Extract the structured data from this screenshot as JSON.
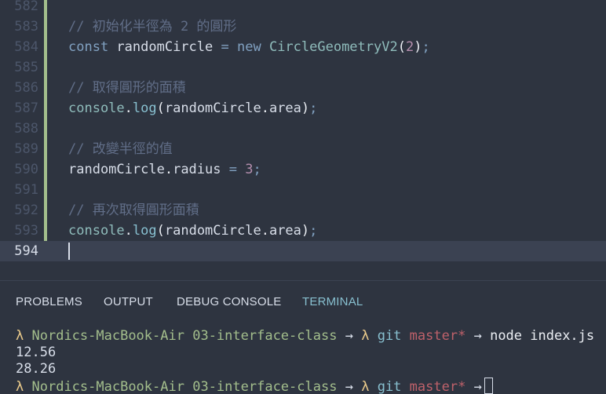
{
  "editor": {
    "lines": [
      {
        "num": "582",
        "tokens": []
      },
      {
        "num": "583",
        "tokens": [
          {
            "t": "comment",
            "v": "// 初始化半徑為 2 的圓形"
          }
        ]
      },
      {
        "num": "584",
        "tokens": [
          {
            "t": "keyword",
            "v": "const"
          },
          {
            "t": "plain",
            "v": " randomCircle "
          },
          {
            "t": "op",
            "v": "="
          },
          {
            "t": "plain",
            "v": " "
          },
          {
            "t": "keyword",
            "v": "new"
          },
          {
            "t": "plain",
            "v": " "
          },
          {
            "t": "class",
            "v": "CircleGeometryV2"
          },
          {
            "t": "punct",
            "v": "("
          },
          {
            "t": "num",
            "v": "2"
          },
          {
            "t": "punct",
            "v": ")"
          },
          {
            "t": "semi",
            "v": ";"
          }
        ]
      },
      {
        "num": "585",
        "tokens": []
      },
      {
        "num": "586",
        "tokens": [
          {
            "t": "comment",
            "v": "// 取得圓形的面積"
          }
        ]
      },
      {
        "num": "587",
        "tokens": [
          {
            "t": "class",
            "v": "console"
          },
          {
            "t": "punct",
            "v": "."
          },
          {
            "t": "func",
            "v": "log"
          },
          {
            "t": "punct",
            "v": "("
          },
          {
            "t": "plain",
            "v": "randomCircle"
          },
          {
            "t": "punct",
            "v": "."
          },
          {
            "t": "plain",
            "v": "area"
          },
          {
            "t": "punct",
            "v": ")"
          },
          {
            "t": "semi",
            "v": ";"
          }
        ]
      },
      {
        "num": "588",
        "tokens": []
      },
      {
        "num": "589",
        "tokens": [
          {
            "t": "comment",
            "v": "// 改變半徑的值"
          }
        ]
      },
      {
        "num": "590",
        "tokens": [
          {
            "t": "plain",
            "v": "randomCircle"
          },
          {
            "t": "punct",
            "v": "."
          },
          {
            "t": "plain",
            "v": "radius "
          },
          {
            "t": "op",
            "v": "="
          },
          {
            "t": "plain",
            "v": " "
          },
          {
            "t": "num",
            "v": "3"
          },
          {
            "t": "semi",
            "v": ";"
          }
        ]
      },
      {
        "num": "591",
        "tokens": []
      },
      {
        "num": "592",
        "tokens": [
          {
            "t": "comment",
            "v": "// 再次取得圓形面積"
          }
        ]
      },
      {
        "num": "593",
        "tokens": [
          {
            "t": "class",
            "v": "console"
          },
          {
            "t": "punct",
            "v": "."
          },
          {
            "t": "func",
            "v": "log"
          },
          {
            "t": "punct",
            "v": "("
          },
          {
            "t": "plain",
            "v": "randomCircle"
          },
          {
            "t": "punct",
            "v": "."
          },
          {
            "t": "plain",
            "v": "area"
          },
          {
            "t": "punct",
            "v": ")"
          },
          {
            "t": "semi",
            "v": ";"
          }
        ]
      },
      {
        "num": "594",
        "tokens": [],
        "current": true
      }
    ]
  },
  "panel": {
    "tabs": [
      {
        "label": "PROBLEMS",
        "active": false
      },
      {
        "label": "OUTPUT",
        "active": false
      },
      {
        "label": "DEBUG CONSOLE",
        "active": false
      },
      {
        "label": "TERMINAL",
        "active": true
      }
    ]
  },
  "terminal": {
    "prompt": {
      "lambda": "λ",
      "host": "Nordics-MacBook-Air",
      "dir": "03-interface-class",
      "arrow": "→",
      "git": "git",
      "branch": "master*"
    },
    "command": "node index.js",
    "output": [
      "12.56",
      "28.26"
    ]
  },
  "colors": {
    "background": "#2e3440",
    "current_line": "#3b4252",
    "git_added": "#a3be8c",
    "active_tab": "#88c0d0"
  }
}
